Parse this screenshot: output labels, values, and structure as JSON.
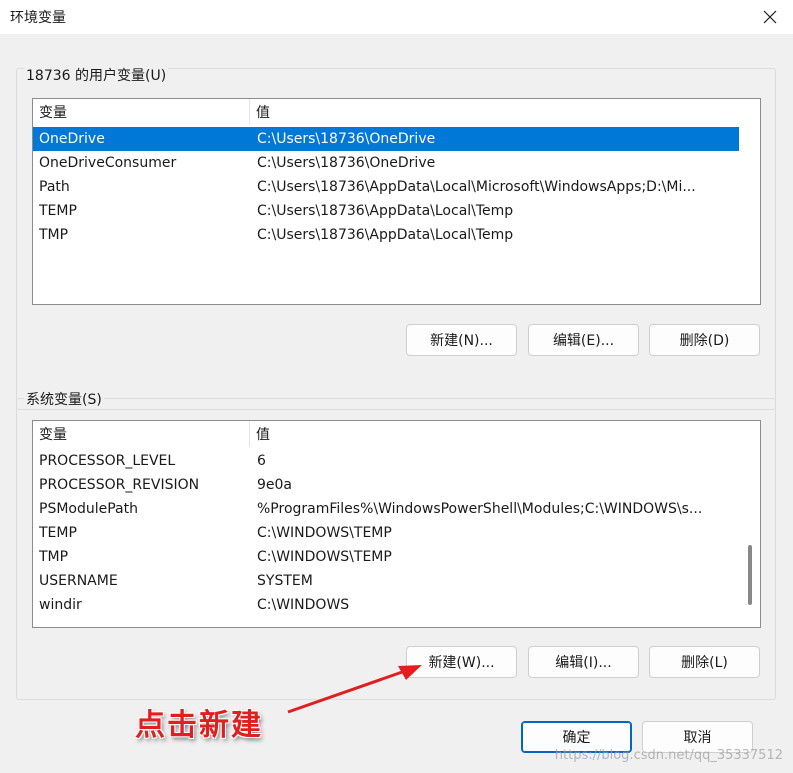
{
  "window": {
    "title": "环境变量"
  },
  "user_group": {
    "title": "18736 的用户变量(U)",
    "headers": {
      "name": "变量",
      "value": "值"
    },
    "rows": [
      {
        "name": "OneDrive",
        "value": "C:\\Users\\18736\\OneDrive",
        "selected": true
      },
      {
        "name": "OneDriveConsumer",
        "value": "C:\\Users\\18736\\OneDrive"
      },
      {
        "name": "Path",
        "value": "C:\\Users\\18736\\AppData\\Local\\Microsoft\\WindowsApps;D:\\Mi..."
      },
      {
        "name": "TEMP",
        "value": "C:\\Users\\18736\\AppData\\Local\\Temp"
      },
      {
        "name": "TMP",
        "value": "C:\\Users\\18736\\AppData\\Local\\Temp"
      }
    ],
    "buttons": {
      "new": "新建(N)...",
      "edit": "编辑(E)...",
      "delete": "删除(D)"
    }
  },
  "system_group": {
    "title": "系统变量(S)",
    "headers": {
      "name": "变量",
      "value": "值"
    },
    "rows": [
      {
        "name": "PROCESSOR_LEVEL",
        "value": "6"
      },
      {
        "name": "PROCESSOR_REVISION",
        "value": "9e0a"
      },
      {
        "name": "PSModulePath",
        "value": "%ProgramFiles%\\WindowsPowerShell\\Modules;C:\\WINDOWS\\s..."
      },
      {
        "name": "TEMP",
        "value": "C:\\WINDOWS\\TEMP"
      },
      {
        "name": "TMP",
        "value": "C:\\WINDOWS\\TEMP"
      },
      {
        "name": "USERNAME",
        "value": "SYSTEM"
      },
      {
        "name": "windir",
        "value": "C:\\WINDOWS"
      }
    ],
    "buttons": {
      "new": "新建(W)...",
      "edit": "编辑(I)...",
      "delete": "删除(L)"
    }
  },
  "footer": {
    "ok": "确定",
    "cancel": "取消"
  },
  "annotation": {
    "text": "点击新建",
    "color": "#e02020"
  },
  "watermark": "https://blog.csdn.net/qq_35337512",
  "colors": {
    "selection": "#0078d7",
    "dialog_bg": "#f0f0f0",
    "primary_border": "#0067c0"
  },
  "icons": {
    "close": "close-icon"
  }
}
